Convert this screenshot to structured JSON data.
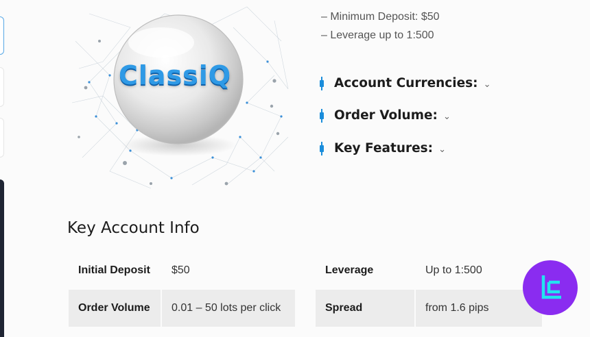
{
  "product": {
    "logo_text": "ClassiQ"
  },
  "summary_lines": [
    "– Minimum Deposit: $50",
    "– Leverage up to 1:500"
  ],
  "accordions": [
    {
      "label": "Account Currencies:"
    },
    {
      "label": "Order Volume:"
    },
    {
      "label": "Key Features:"
    }
  ],
  "section_title": "Key Account Info",
  "table": {
    "rows": [
      {
        "k1": "Initial Deposit",
        "v1": "$50",
        "k2": "Leverage",
        "v2": "Up to 1:500"
      },
      {
        "k1": "Order Volume",
        "v1": "0.01 – 50 lots per click",
        "k2": "Spread",
        "v2": "from 1.6 pips"
      }
    ]
  },
  "colors": {
    "accent": "#1a8ddb",
    "badge": "#8a2cf0",
    "badge_mark": "#22e3f0"
  }
}
